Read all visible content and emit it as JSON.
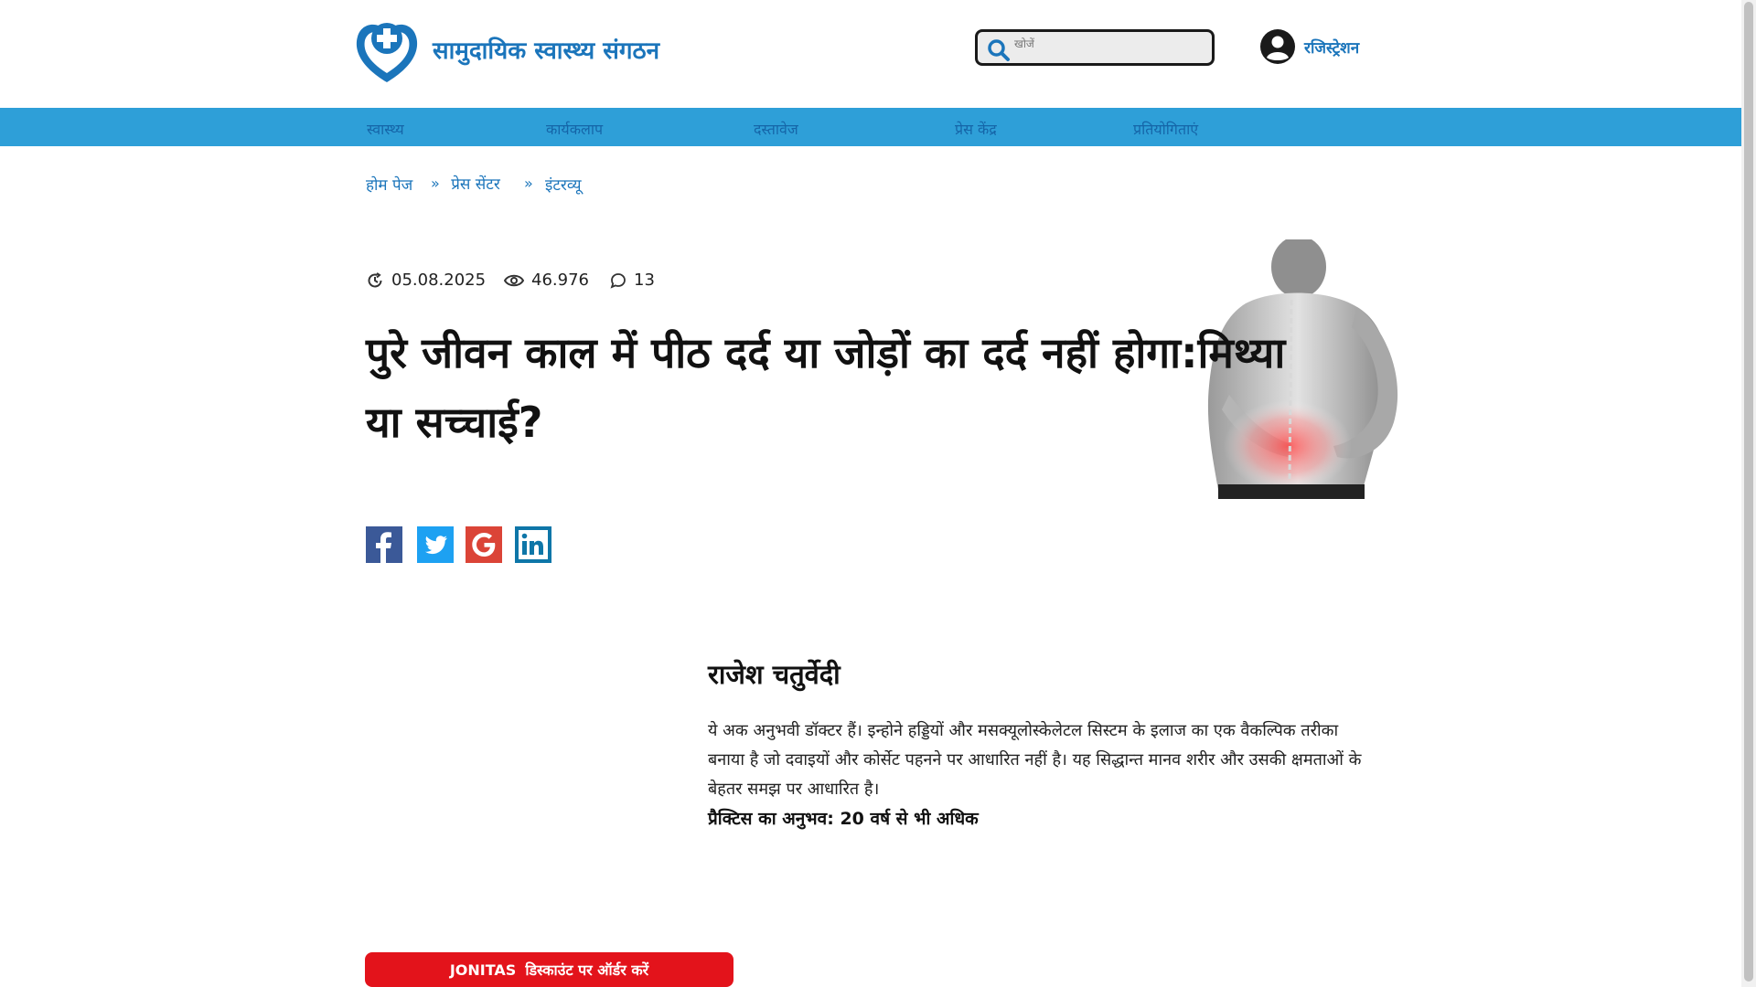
{
  "header": {
    "site_name": "सामुदायिक स्वास्थ्य संगठन",
    "logo_icon": "heart-cross-icon",
    "search": {
      "placeholder": "खोजें",
      "icon": "search-icon"
    },
    "register_label": "रजिस्ट्रेशन",
    "register_icon": "user-circle-icon"
  },
  "nav": {
    "items": [
      {
        "label": "स्वास्थ्य"
      },
      {
        "label": "कार्यकलाप"
      },
      {
        "label": "दस्तावेज"
      },
      {
        "label": "प्रेस केंद्र"
      },
      {
        "label": "प्रतियोगिताएं"
      }
    ],
    "background": "#2e9fd8"
  },
  "breadcrumb": {
    "items": [
      {
        "label": "होम पेज"
      },
      {
        "label": "प्रेस सेंटर"
      },
      {
        "label": "इंटरव्यू"
      }
    ]
  },
  "article": {
    "date": "05.08.2025",
    "views": "46.976",
    "comments": "13",
    "title": "पुरे जीवन काल में पीठ दर्द या जोड़ों का दर्द नहीं होगा:मिथ्या या सच्चाई?"
  },
  "share": {
    "facebook_icon": "facebook-icon",
    "twitter_icon": "twitter-icon",
    "google_icon": "google-icon",
    "linkedin_icon": "linkedin-icon"
  },
  "author": {
    "name": "राजेश चतुर्वेदी",
    "bio": "ये अक अनुभवी डॉक्टर हैं। इन्होने हड्डियों और मसक्यूलोस्केलेटल सिस्टम के इलाज का एक वैकल्पिक तरीका बनाया है जो दवाइयों और कोर्सेट पहनने पर आधारित नहीं है। यह सिद्धान्त मानव शरीर और उसकी क्षमताओं के बेहतर समझ पर आधारित है।",
    "experience": "प्रैक्टिस का अनुभव: 20 वर्ष से भी अधिक"
  },
  "cta": {
    "brand": "JONITAS",
    "label": "डिस्काउंट पर ऑर्डर करें",
    "color": "#e3131b"
  },
  "colors": {
    "brand_blue": "#1b75bb",
    "nav_text": "#1565a8"
  }
}
